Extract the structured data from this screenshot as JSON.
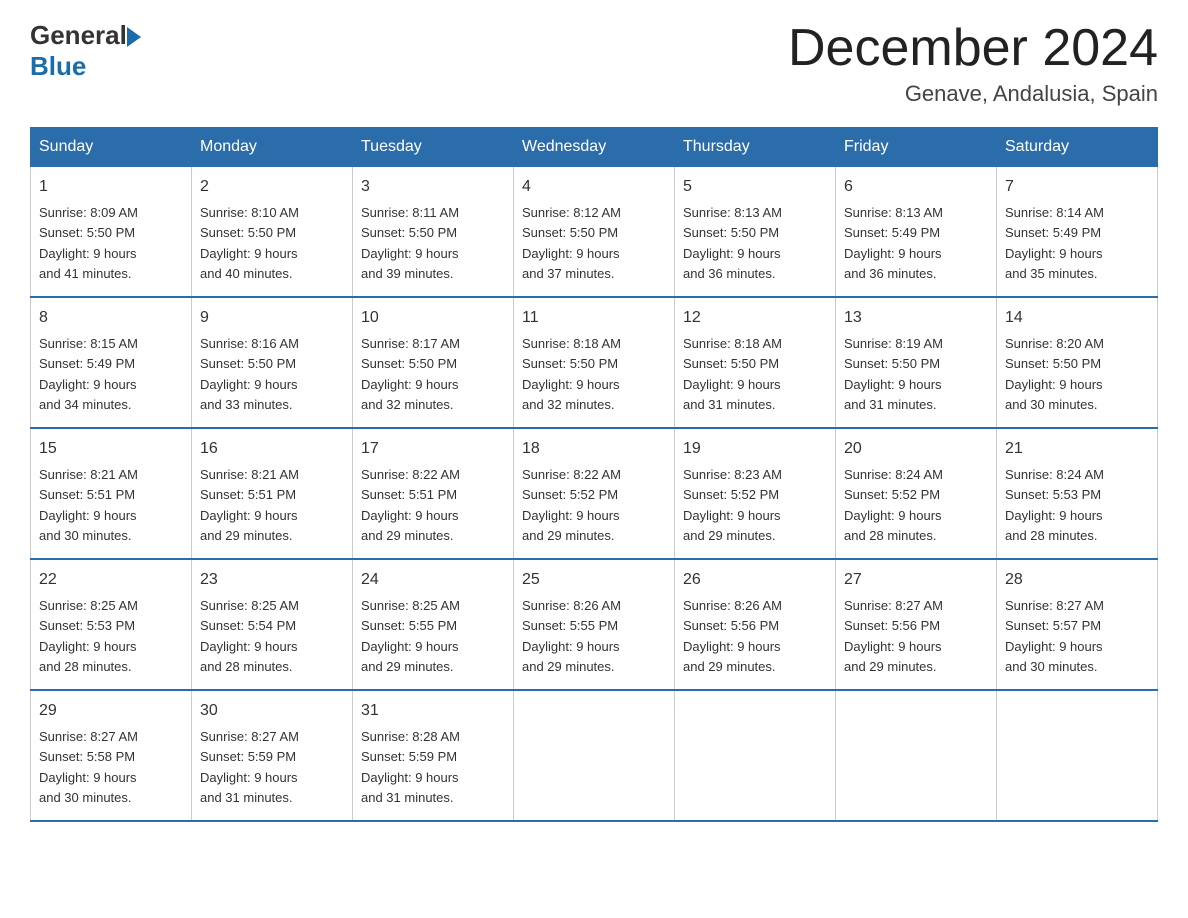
{
  "header": {
    "logo_general": "General",
    "logo_blue": "Blue",
    "month_title": "December 2024",
    "location": "Genave, Andalusia, Spain"
  },
  "days_of_week": [
    "Sunday",
    "Monday",
    "Tuesday",
    "Wednesday",
    "Thursday",
    "Friday",
    "Saturday"
  ],
  "weeks": [
    [
      {
        "day": "1",
        "sunrise": "8:09 AM",
        "sunset": "5:50 PM",
        "daylight": "9 hours and 41 minutes."
      },
      {
        "day": "2",
        "sunrise": "8:10 AM",
        "sunset": "5:50 PM",
        "daylight": "9 hours and 40 minutes."
      },
      {
        "day": "3",
        "sunrise": "8:11 AM",
        "sunset": "5:50 PM",
        "daylight": "9 hours and 39 minutes."
      },
      {
        "day": "4",
        "sunrise": "8:12 AM",
        "sunset": "5:50 PM",
        "daylight": "9 hours and 37 minutes."
      },
      {
        "day": "5",
        "sunrise": "8:13 AM",
        "sunset": "5:50 PM",
        "daylight": "9 hours and 36 minutes."
      },
      {
        "day": "6",
        "sunrise": "8:13 AM",
        "sunset": "5:49 PM",
        "daylight": "9 hours and 36 minutes."
      },
      {
        "day": "7",
        "sunrise": "8:14 AM",
        "sunset": "5:49 PM",
        "daylight": "9 hours and 35 minutes."
      }
    ],
    [
      {
        "day": "8",
        "sunrise": "8:15 AM",
        "sunset": "5:49 PM",
        "daylight": "9 hours and 34 minutes."
      },
      {
        "day": "9",
        "sunrise": "8:16 AM",
        "sunset": "5:50 PM",
        "daylight": "9 hours and 33 minutes."
      },
      {
        "day": "10",
        "sunrise": "8:17 AM",
        "sunset": "5:50 PM",
        "daylight": "9 hours and 32 minutes."
      },
      {
        "day": "11",
        "sunrise": "8:18 AM",
        "sunset": "5:50 PM",
        "daylight": "9 hours and 32 minutes."
      },
      {
        "day": "12",
        "sunrise": "8:18 AM",
        "sunset": "5:50 PM",
        "daylight": "9 hours and 31 minutes."
      },
      {
        "day": "13",
        "sunrise": "8:19 AM",
        "sunset": "5:50 PM",
        "daylight": "9 hours and 31 minutes."
      },
      {
        "day": "14",
        "sunrise": "8:20 AM",
        "sunset": "5:50 PM",
        "daylight": "9 hours and 30 minutes."
      }
    ],
    [
      {
        "day": "15",
        "sunrise": "8:21 AM",
        "sunset": "5:51 PM",
        "daylight": "9 hours and 30 minutes."
      },
      {
        "day": "16",
        "sunrise": "8:21 AM",
        "sunset": "5:51 PM",
        "daylight": "9 hours and 29 minutes."
      },
      {
        "day": "17",
        "sunrise": "8:22 AM",
        "sunset": "5:51 PM",
        "daylight": "9 hours and 29 minutes."
      },
      {
        "day": "18",
        "sunrise": "8:22 AM",
        "sunset": "5:52 PM",
        "daylight": "9 hours and 29 minutes."
      },
      {
        "day": "19",
        "sunrise": "8:23 AM",
        "sunset": "5:52 PM",
        "daylight": "9 hours and 29 minutes."
      },
      {
        "day": "20",
        "sunrise": "8:24 AM",
        "sunset": "5:52 PM",
        "daylight": "9 hours and 28 minutes."
      },
      {
        "day": "21",
        "sunrise": "8:24 AM",
        "sunset": "5:53 PM",
        "daylight": "9 hours and 28 minutes."
      }
    ],
    [
      {
        "day": "22",
        "sunrise": "8:25 AM",
        "sunset": "5:53 PM",
        "daylight": "9 hours and 28 minutes."
      },
      {
        "day": "23",
        "sunrise": "8:25 AM",
        "sunset": "5:54 PM",
        "daylight": "9 hours and 28 minutes."
      },
      {
        "day": "24",
        "sunrise": "8:25 AM",
        "sunset": "5:55 PM",
        "daylight": "9 hours and 29 minutes."
      },
      {
        "day": "25",
        "sunrise": "8:26 AM",
        "sunset": "5:55 PM",
        "daylight": "9 hours and 29 minutes."
      },
      {
        "day": "26",
        "sunrise": "8:26 AM",
        "sunset": "5:56 PM",
        "daylight": "9 hours and 29 minutes."
      },
      {
        "day": "27",
        "sunrise": "8:27 AM",
        "sunset": "5:56 PM",
        "daylight": "9 hours and 29 minutes."
      },
      {
        "day": "28",
        "sunrise": "8:27 AM",
        "sunset": "5:57 PM",
        "daylight": "9 hours and 30 minutes."
      }
    ],
    [
      {
        "day": "29",
        "sunrise": "8:27 AM",
        "sunset": "5:58 PM",
        "daylight": "9 hours and 30 minutes."
      },
      {
        "day": "30",
        "sunrise": "8:27 AM",
        "sunset": "5:59 PM",
        "daylight": "9 hours and 31 minutes."
      },
      {
        "day": "31",
        "sunrise": "8:28 AM",
        "sunset": "5:59 PM",
        "daylight": "9 hours and 31 minutes."
      },
      null,
      null,
      null,
      null
    ]
  ]
}
